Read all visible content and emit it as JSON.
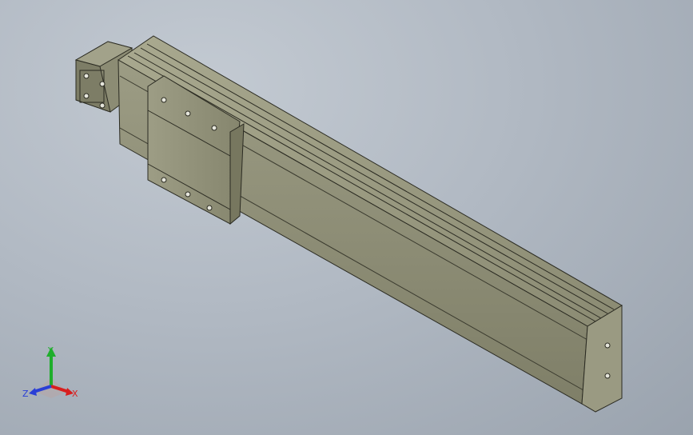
{
  "viewport": {
    "background_top": "#c3cad2",
    "background_bottom": "#9aa3ae"
  },
  "model": {
    "body_color": "#8a8a73",
    "edge_color": "#2b2b22"
  },
  "triad": {
    "x_label": "X",
    "y_label": "Y",
    "z_label": "Z",
    "x_color": "#d81e1e",
    "y_color": "#1fae2c",
    "z_color": "#2a3fd6"
  }
}
